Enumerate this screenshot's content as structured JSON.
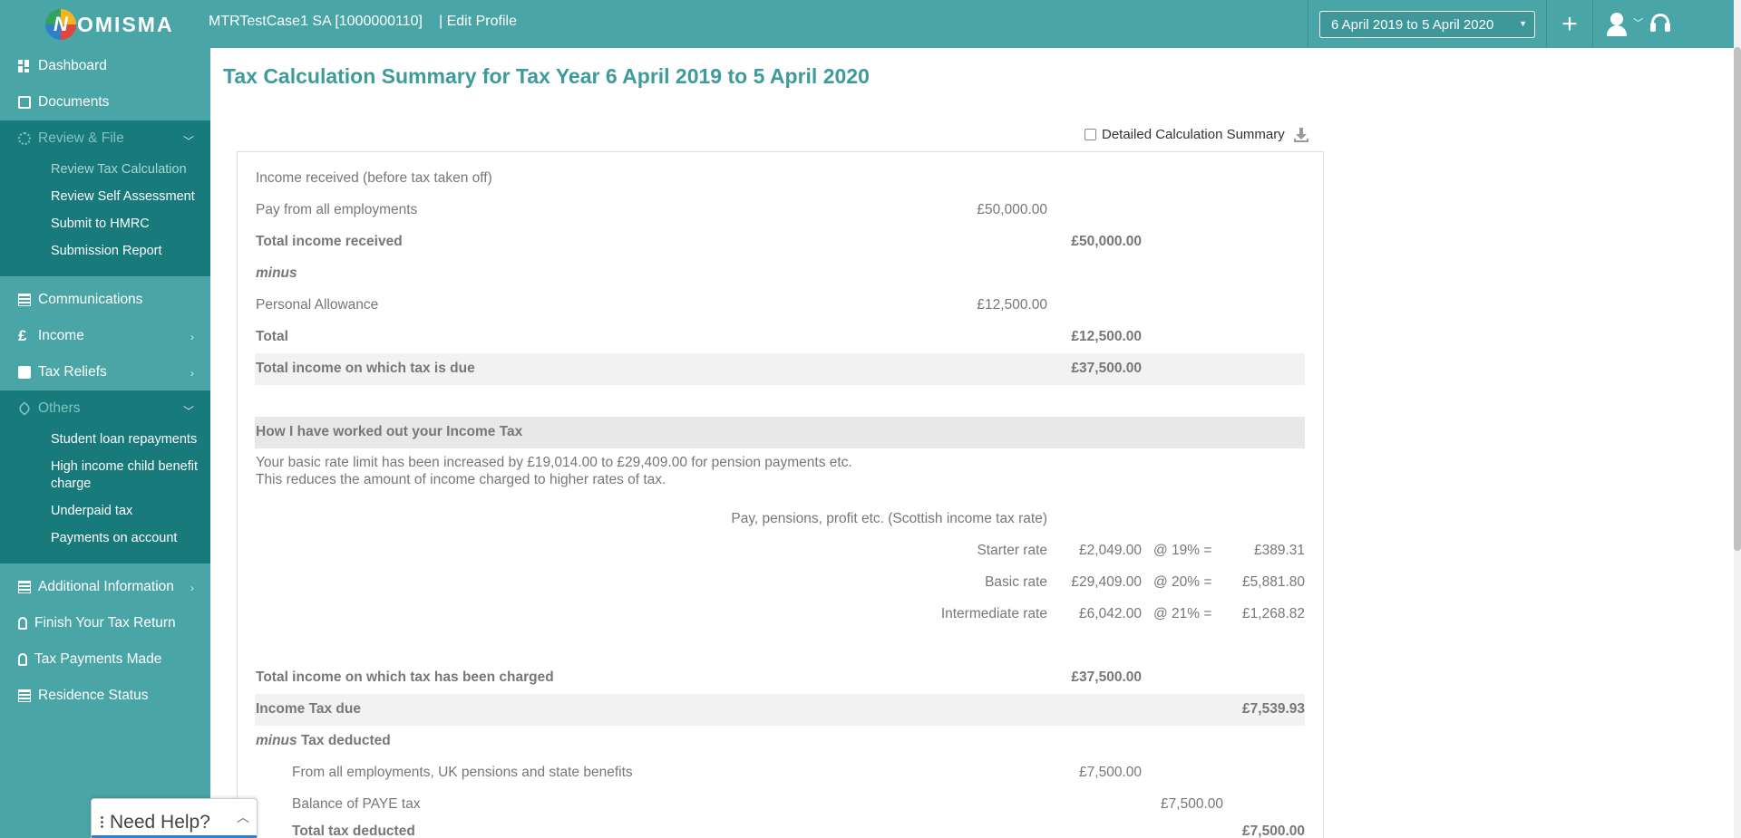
{
  "header": {
    "logo_text": "OMISMA",
    "logo_mark": "N",
    "client": "MTRTestCase1 SA [1000000110]",
    "edit_profile": "| Edit Profile",
    "year_selected": "6 April 2019 to 5 April 2020",
    "icons": [
      "plus-icon",
      "user-icon",
      "headset-icon"
    ]
  },
  "sidebar": {
    "dashboard": "Dashboard",
    "documents": "Documents",
    "review_file": "Review & File",
    "review_sub": [
      "Review Tax Calculation",
      "Review Self Assessment",
      "Submit to HMRC",
      "Submission Report"
    ],
    "communications": "Communications",
    "income": "Income",
    "tax_reliefs": "Tax Reliefs",
    "others": "Others",
    "others_sub": [
      "Student loan repayments",
      "High income child benefit charge",
      "Underpaid tax",
      "Payments on account"
    ],
    "additional_information": "Additional Information",
    "finish_return": "Finish Your Tax Return",
    "tax_payments": "Tax Payments Made",
    "residence_status": "Residence Status"
  },
  "need_help": "Need Help?",
  "main": {
    "title": "Tax Calculation Summary for Tax Year 6 April 2019 to 5 April 2020",
    "detailed_summary_label": "Detailed Calculation Summary",
    "detailed_summary_checked": false,
    "income_heading": "Income received (before tax taken off)",
    "pay_label": "Pay from all employments",
    "pay_value": "£50,000.00",
    "total_income_label": "Total income received",
    "total_income_value": "£50,000.00",
    "minus": "minus",
    "personal_allowance_label": "Personal Allowance",
    "personal_allowance_value": "£12,500.00",
    "total_label": "Total",
    "total_value": "£12,500.00",
    "taxable_label": "Total income on which tax is due",
    "taxable_value": "£37,500.00",
    "how_heading": "How I have worked out your Income Tax",
    "note_line1": "Your basic rate limit has been increased by £19,014.00 to £29,409.00 for pension payments etc.",
    "note_line2": "This reduces the amount of income charged to higher rates of tax.",
    "scottish_heading": "Pay, pensions, profit etc. (Scottish income tax rate)",
    "bands": [
      {
        "name": "Starter rate",
        "amount": "£2,049.00",
        "rate": "@ 19% =",
        "tax": "£389.31"
      },
      {
        "name": "Basic rate",
        "amount": "£29,409.00",
        "rate": "@ 20% =",
        "tax": "£5,881.80"
      },
      {
        "name": "Intermediate rate",
        "amount": "£6,042.00",
        "rate": "@ 21% =",
        "tax": "£1,268.82"
      }
    ],
    "charged_label": "Total income on which tax has been charged",
    "charged_value": "£37,500.00",
    "tax_due_label": "Income Tax due",
    "tax_due_value": "£7,539.93",
    "tax_deducted_label": "Tax deducted",
    "from_employments_label": "From all employments, UK pensions and state benefits",
    "from_employments_value": "£7,500.00",
    "balance_paye_label": "Balance of PAYE tax",
    "balance_paye_value": "£7,500.00",
    "total_deducted_label": "Total tax deducted",
    "total_deducted_value": "£7,500.00"
  }
}
